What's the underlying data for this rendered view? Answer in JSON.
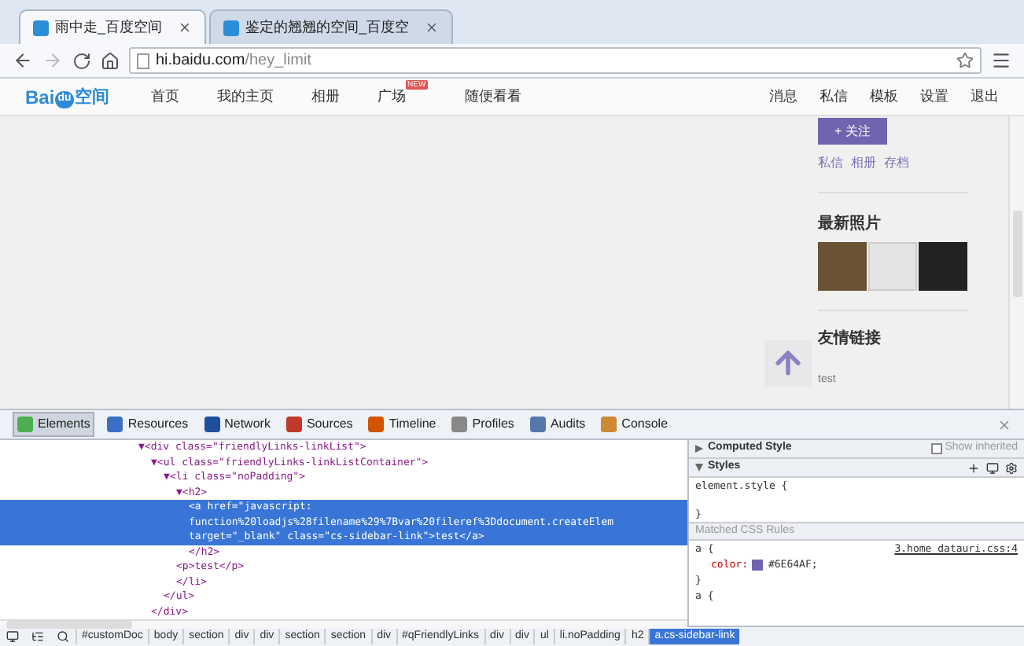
{
  "browser": {
    "tabs": [
      {
        "title": "雨中走_百度空间",
        "selected": true
      },
      {
        "title": "鉴定的翘翘的空间_百度空",
        "selected": false
      }
    ],
    "address": {
      "host": "hi.baidu.com",
      "path": "/hey_limit"
    }
  },
  "site": {
    "logo": {
      "latin": "Bai",
      "paw": "du",
      "cjk": "空间"
    },
    "nav": [
      {
        "label": "首页"
      },
      {
        "label": "我的主页"
      },
      {
        "label": "相册"
      },
      {
        "label": "广场",
        "badge": "NEW"
      },
      {
        "label": "随便看看"
      }
    ],
    "user_nav": [
      {
        "label": "消息"
      },
      {
        "label": "私信"
      },
      {
        "label": "模板"
      },
      {
        "label": "设置"
      },
      {
        "label": "退出"
      }
    ]
  },
  "sidebar": {
    "follow_button": "+ 关注",
    "links": [
      "私信",
      "相册",
      "存档"
    ],
    "photos_title": "最新照片",
    "friends_title": "友情链接",
    "friend_text": "test"
  },
  "devtools": {
    "panels": [
      {
        "label": "Elements",
        "selected": true
      },
      {
        "label": "Resources",
        "selected": false
      },
      {
        "label": "Network",
        "selected": false
      },
      {
        "label": "Sources",
        "selected": false
      },
      {
        "label": "Timeline",
        "selected": false
      },
      {
        "label": "Profiles",
        "selected": false
      },
      {
        "label": "Audits",
        "selected": false
      },
      {
        "label": "Console",
        "selected": false
      }
    ],
    "dom": [
      {
        "open": "▼<div class=\"friendlyLinks-linkList\">",
        "close": "</div>",
        "selected": false,
        "children": [
          {
            "open": "▼<ul class=\"friendlyLinks-linkListContainer\">",
            "close": "</ul>",
            "selected": false,
            "children": [
              {
                "open": "▼<li class=\"noPadding\">",
                "close": "</li>",
                "selected": false,
                "children": [
                  {
                    "open": "▼<h2>",
                    "close": "</h2>",
                    "selected": false,
                    "children": [
                      {
                        "lines": [
                          "<a href=\"javascript:",
                          "function%20loadjs%28filename%29%7Bvar%20fileref%3Ddocument.createElem",
                          "target=\"_blank\" class=\"cs-sidebar-link\">test</a>"
                        ],
                        "selected": true
                      }
                    ]
                  },
                  {
                    "lines": [
                      "<p>test</p>"
                    ],
                    "selected": false
                  }
                ]
              }
            ]
          }
        ]
      }
    ],
    "styles": {
      "computed_title": "Computed Style",
      "show_inherited": {
        "label": "Show inherited",
        "checked": false
      },
      "styles_title": "Styles",
      "element_style": "element.style {",
      "element_close": "}",
      "matched_title": "Matched CSS Rules",
      "rule_selector": "a {",
      "rule_source": "3.home_datauri.css:4",
      "rule_property": "color:",
      "rule_value": "#6E64AF;",
      "rule_close": "}",
      "next_selector": "a {"
    },
    "breadcrumbs": [
      {
        "label": "#customDoc",
        "selected": false
      },
      {
        "label": "body",
        "selected": false
      },
      {
        "label": "section",
        "selected": false
      },
      {
        "label": "div",
        "selected": false
      },
      {
        "label": "div",
        "selected": false
      },
      {
        "label": "section",
        "selected": false
      },
      {
        "label": "section",
        "selected": false
      },
      {
        "label": "div",
        "selected": false
      },
      {
        "label": "#qFriendlyLinks",
        "selected": false
      },
      {
        "label": "div",
        "selected": false
      },
      {
        "label": "div",
        "selected": false
      },
      {
        "label": "ul",
        "selected": false
      },
      {
        "label": "li.noPadding",
        "selected": false
      },
      {
        "label": "h2",
        "selected": false
      },
      {
        "label": "a.cs-sidebar-link",
        "selected": true
      }
    ]
  }
}
